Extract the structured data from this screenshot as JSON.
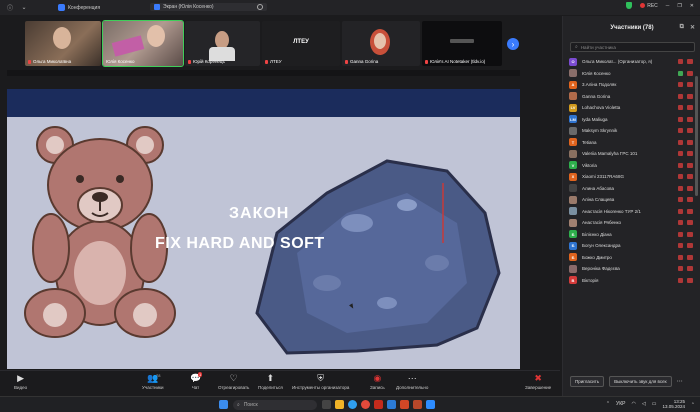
{
  "titlebar": {
    "app_tab": "Конференция",
    "screen_tab": "Экран (Юлія Косенко)",
    "rec_label": "REC"
  },
  "strip": {
    "tiles": [
      {
        "name": "Ольга Миколаївна"
      },
      {
        "name": "Юлія Косенко"
      },
      {
        "name": "Юрій Коренець"
      },
      {
        "name": "ЛТЕУ",
        "center_text": "ЛТЕУ"
      },
      {
        "name": "Ganna Gorina"
      },
      {
        "name": "Юлія's AI Notetaker (tldv.io)"
      }
    ]
  },
  "slide": {
    "title_line1": "ЗАКОН",
    "title_line2": "FIX HARD AND SOFT"
  },
  "toolbar": {
    "video": "Видео",
    "participants": "Участники",
    "participants_count": "78",
    "chat": "Чат",
    "chat_badge": "1",
    "react": "Отреагировать",
    "share": "Поделиться",
    "host_tools": "Инструменты организатора",
    "record": "Запись",
    "more": "Дополнительно",
    "end": "Завершение"
  },
  "panel": {
    "title": "Участники (78)",
    "search_placeholder": "Найти участника",
    "participants": [
      {
        "name": "Ольга Миколаї... (Организатор, я)",
        "initials": "O",
        "color": "#7b4bd1"
      },
      {
        "name": "Юлія Косенко",
        "initials": "",
        "color": "#8a6e6a"
      },
      {
        "name": "3.Аліна Подоляк",
        "initials": "А",
        "color": "#e0641e"
      },
      {
        "name": "Ganna Gorina",
        "initials": "",
        "color": "#b06a4a"
      },
      {
        "name": "Lohachova Violetta",
        "initials": "LV",
        "color": "#d19a1c"
      },
      {
        "name": "Iyda Maliuga",
        "initials": "LM",
        "color": "#2f74d0"
      },
      {
        "name": "Maksym Skrynnik",
        "initials": "",
        "color": "#6a6a6a"
      },
      {
        "name": "Tetiana",
        "initials": "T",
        "color": "#e0641e"
      },
      {
        "name": "Valeriia Mamalyha ГРС 101",
        "initials": "",
        "color": "#8a7060"
      },
      {
        "name": "Viktoria",
        "initials": "V",
        "color": "#2eae4c"
      },
      {
        "name": "Xiaomi 23117RA68G",
        "initials": "X",
        "color": "#e0641e"
      },
      {
        "name": "Алина Абасова",
        "initials": "",
        "color": "#444"
      },
      {
        "name": "Аліна Слащева",
        "initials": "",
        "color": "#9a7a6a"
      },
      {
        "name": "Анастасія Нікогенко ТУР 2/1",
        "initials": "",
        "color": "#7a8fa0"
      },
      {
        "name": "Анастасія Рябенко",
        "initials": "",
        "color": "#a08070"
      },
      {
        "name": "Білієнко Діана",
        "initials": "Б",
        "color": "#2eae4c"
      },
      {
        "name": "Богун Олександра",
        "initials": "Б",
        "color": "#2f74d0"
      },
      {
        "name": "Божко Дмитро",
        "initials": "Б",
        "color": "#e0641e"
      },
      {
        "name": "Вероніка Фадєєва",
        "initials": "",
        "color": "#8a6a6a"
      },
      {
        "name": "Вікторія",
        "initials": "В",
        "color": "#d43a3a"
      }
    ],
    "invite": "Пригласить",
    "mute_all": "Выключить звук для всех"
  },
  "taskbar": {
    "search": "Поиск",
    "lang": "УКР",
    "time": "13:25",
    "date": "13.05.2024"
  }
}
